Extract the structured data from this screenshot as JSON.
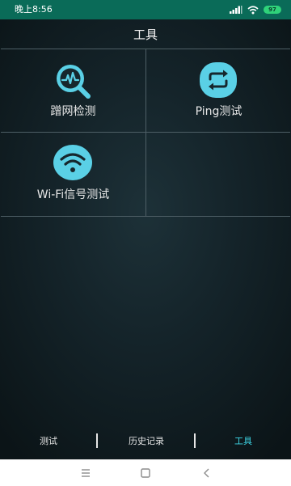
{
  "status_bar": {
    "time": "晚上8:56",
    "battery": "97"
  },
  "header": {
    "title": "工具"
  },
  "tools": [
    {
      "label": "蹭网检测",
      "icon": "network-scan-icon"
    },
    {
      "label": "Ping测试",
      "icon": "ping-repeat-icon"
    },
    {
      "label": "Wi-Fi信号测试",
      "icon": "wifi-icon"
    }
  ],
  "tabs": [
    {
      "label": "测试",
      "active": false
    },
    {
      "label": "历史记录",
      "active": false
    },
    {
      "label": "工具",
      "active": true
    }
  ],
  "colors": {
    "accent": "#3dd6e6",
    "icon_fill": "#5ad0e6",
    "status_bar": "#0a6b58",
    "background": "#142329"
  },
  "system_nav": {
    "icons": [
      "menu-icon",
      "home-icon",
      "back-icon"
    ]
  }
}
